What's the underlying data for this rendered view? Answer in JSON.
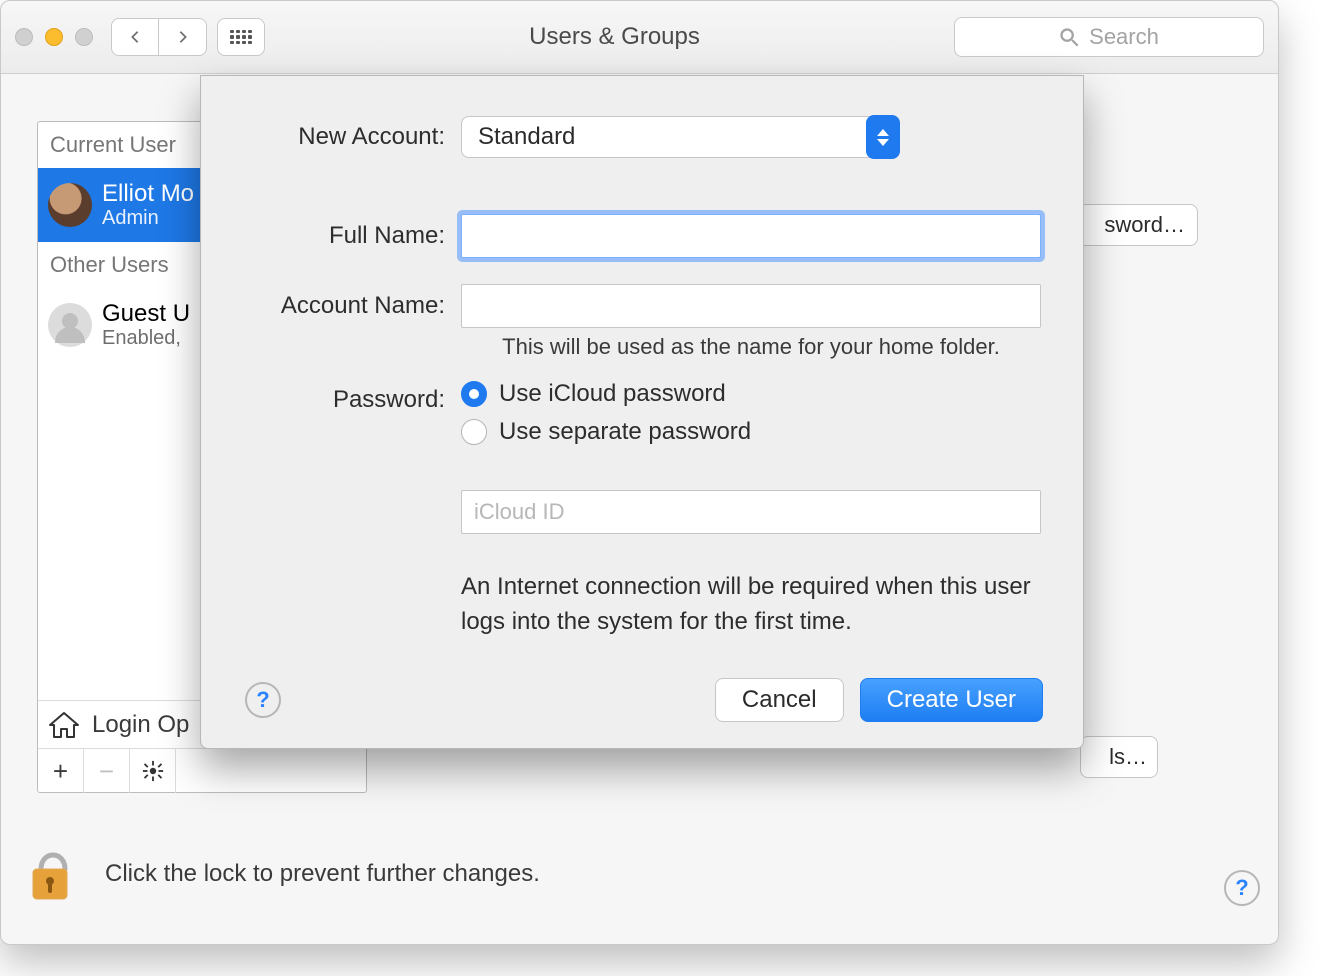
{
  "window": {
    "title": "Users & Groups",
    "search_placeholder": "Search"
  },
  "sidebar": {
    "current_user_header": "Current User",
    "other_users_header": "Other Users",
    "current_user": {
      "name": "Elliot Mo",
      "role": "Admin"
    },
    "guest_user": {
      "name": "Guest U",
      "status": "Enabled,"
    },
    "login_options_label": "Login Op"
  },
  "background_buttons": {
    "change_password_truncated": "sword…",
    "open_truncated": "ls…"
  },
  "lock_message": "Click the lock to prevent further changes.",
  "sheet": {
    "labels": {
      "new_account": "New Account:",
      "full_name": "Full Name:",
      "account_name": "Account Name:",
      "password": "Password:"
    },
    "new_account_value": "Standard",
    "full_name_value": "",
    "account_name_value": "",
    "account_name_hint": "This will be used as the name for your home folder.",
    "password_options": {
      "icloud": "Use iCloud password",
      "separate": "Use separate password"
    },
    "icloud_placeholder": "iCloud ID",
    "note": "An Internet connection will be required when this user logs into the system for the first time.",
    "cancel": "Cancel",
    "create": "Create User"
  }
}
